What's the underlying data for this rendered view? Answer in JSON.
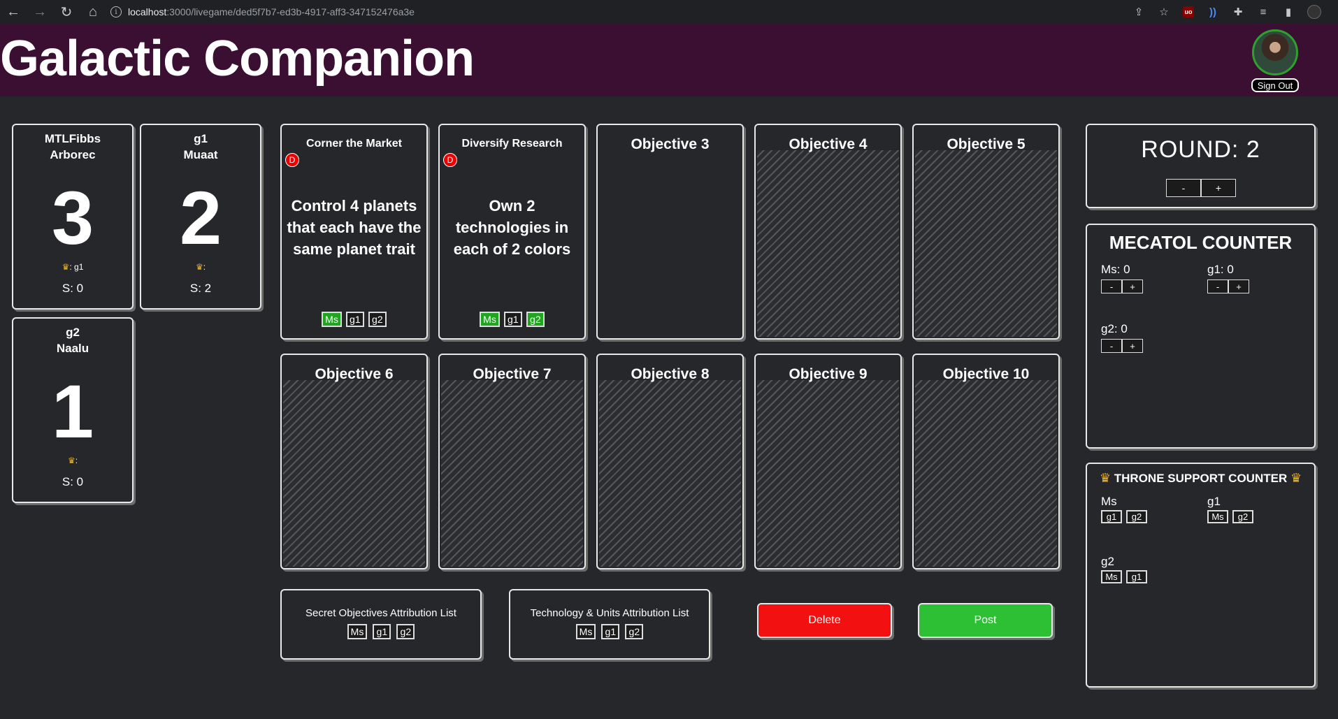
{
  "browser": {
    "url_host": "localhost",
    "url_path": ":3000/livegame/ded5f7b7-ed3b-4917-aff3-347152476a3e"
  },
  "header": {
    "title": "Galactic Companion",
    "sign_out": "Sign Out"
  },
  "players": [
    {
      "name": "MTLFibbs",
      "faction": "Arborec",
      "score": "3",
      "crown": ": g1",
      "secrets": "S: 0"
    },
    {
      "name": "g1",
      "faction": "Muaat",
      "score": "2",
      "crown": ":",
      "secrets": "S: 2"
    },
    {
      "name": "g2",
      "faction": "Naalu",
      "score": "1",
      "crown": ":",
      "secrets": "S: 0"
    }
  ],
  "objectives": [
    {
      "title": "Corner the Market",
      "badge": "D",
      "text": "Control 4 planets that each have the same planet trait",
      "tags": [
        "Ms",
        "g1",
        "g2"
      ]
    },
    {
      "title": "Diversify Research",
      "badge": "D",
      "text": "Own 2 technologies in each of 2 colors",
      "tags": [
        "Ms",
        "g1",
        "g2"
      ]
    },
    {
      "title": "Objective 3"
    },
    {
      "title": "Objective 4"
    },
    {
      "title": "Objective 5"
    },
    {
      "title": "Objective 6"
    },
    {
      "title": "Objective 7"
    },
    {
      "title": "Objective 8"
    },
    {
      "title": "Objective 9"
    },
    {
      "title": "Objective 10"
    }
  ],
  "attribution": {
    "secret": {
      "label": "Secret Objectives Attribution List",
      "tags": [
        "Ms",
        "g1",
        "g2"
      ]
    },
    "tech": {
      "label": "Technology & Units Attribution List",
      "tags": [
        "Ms",
        "g1",
        "g2"
      ]
    }
  },
  "actions": {
    "delete": "Delete",
    "post": "Post"
  },
  "round": {
    "label": "ROUND: 2",
    "minus": "-",
    "plus": "+"
  },
  "mecatol": {
    "title": "MECATOL COUNTER",
    "counters": [
      {
        "label": "Ms: 0"
      },
      {
        "label": "g1: 0"
      },
      {
        "label": "g2: 0"
      }
    ],
    "minus": "-",
    "plus": "+"
  },
  "throne": {
    "title": "THRONE SUPPORT COUNTER",
    "groups": [
      {
        "player": "Ms",
        "tags": [
          "g1",
          "g2"
        ]
      },
      {
        "player": "g1",
        "tags": [
          "Ms",
          "g2"
        ]
      },
      {
        "player": "g2",
        "tags": [
          "Ms",
          "g1"
        ]
      }
    ]
  },
  "colors": {
    "header": "#3a0f32",
    "green": "#1fa51f",
    "red": "#f21010",
    "crown": "#f0b429"
  }
}
